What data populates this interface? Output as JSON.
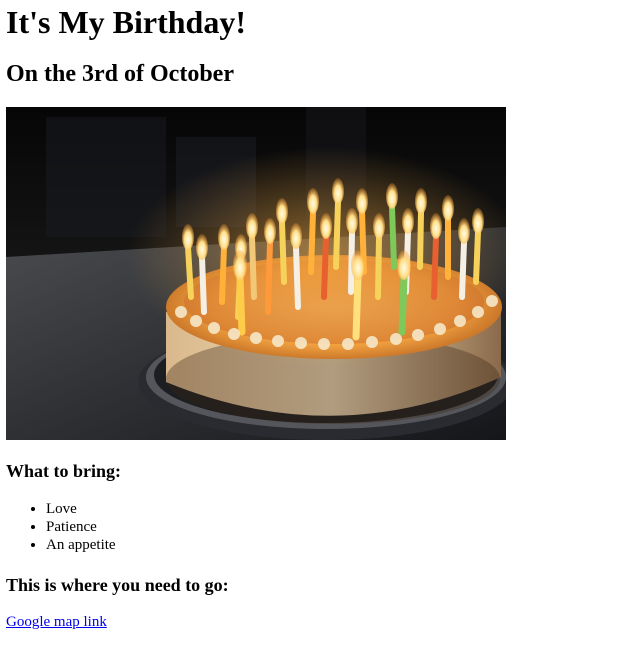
{
  "heading": "It's My Birthday!",
  "subheading": "On the 3rd of October",
  "image": {
    "subject": "birthday-cake-with-lit-candles"
  },
  "bring": {
    "heading": "What to bring:",
    "items": [
      "Love",
      "Patience",
      "An appetite"
    ]
  },
  "directions": {
    "heading": "This is where you need to go:",
    "link_label": "Google map link"
  },
  "colors": {
    "link": "#0000ee",
    "text": "#000000",
    "background": "#ffffff"
  }
}
